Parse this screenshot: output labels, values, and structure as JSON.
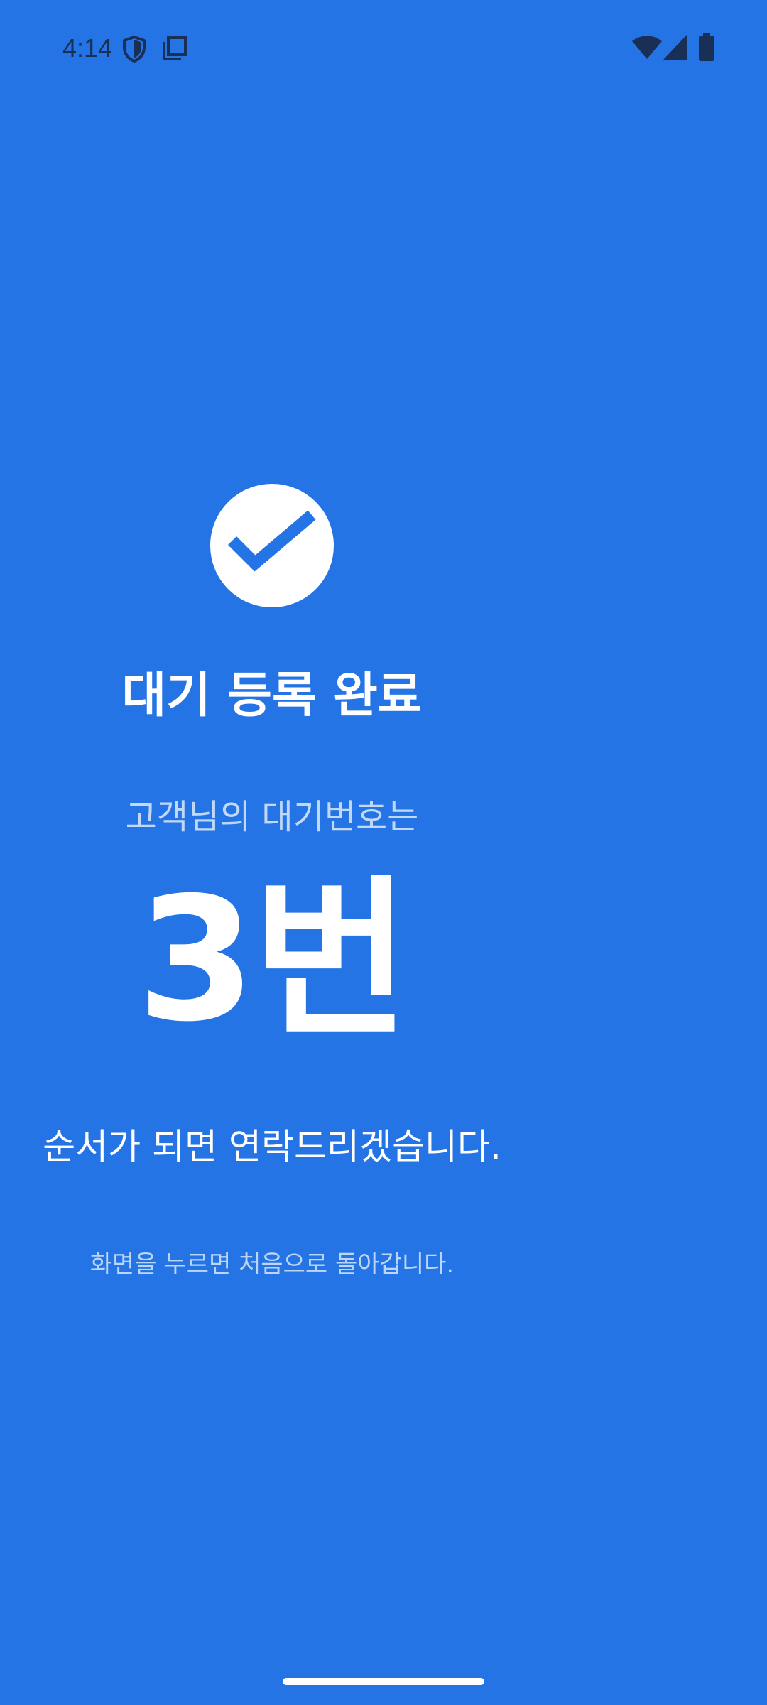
{
  "status_bar": {
    "time": "4:14",
    "icons": [
      "shield-icon",
      "screenshot-icon",
      "wifi-icon",
      "signal-icon",
      "battery-icon"
    ]
  },
  "screen": {
    "check_icon": "check-circle-icon",
    "title": "대기 등록 완료",
    "subtitle": "고객님의 대기번호는",
    "queue_number": "3번",
    "message": "순서가 되면 연락드리겠습니다.",
    "hint": "화면을 누르면 처음으로 돌아갑니다."
  },
  "colors": {
    "background": "#2474E5",
    "foreground": "#FFFFFF",
    "status_icons": "#1A2F55"
  }
}
